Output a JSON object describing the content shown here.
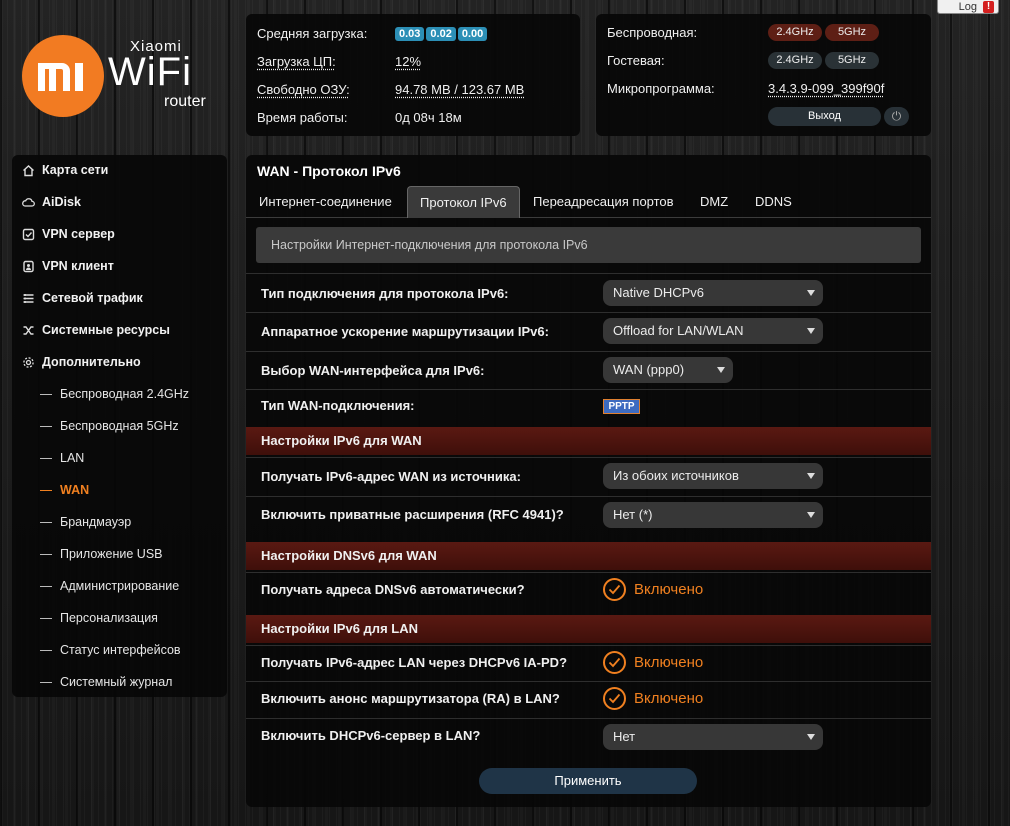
{
  "topbar": {
    "log_label": "Log",
    "warn_symbol": "!"
  },
  "logo": {
    "brand_small": "Xiaomi",
    "brand_big": "WiFi",
    "brand_router": "router",
    "mi_text": "MI"
  },
  "status": {
    "load_label": "Средняя загрузка:",
    "load_values": [
      "0.03",
      "0.02",
      "0.00"
    ],
    "cpu_label": "Загрузка ЦП:",
    "cpu_value": "12%",
    "ram_label": "Свободно ОЗУ:",
    "ram_value": "94.78 MB / 123.67 MB",
    "uptime_label": "Время работы:",
    "uptime_value": "0д 08ч 18м"
  },
  "wireless": {
    "wireless_label": "Беспроводная:",
    "guest_label": "Гостевая:",
    "firmware_label": "Микропрограмма:",
    "band_24": "2.4GHz",
    "band_5": "5GHz",
    "firmware_value": "3.4.3.9-099_399f90f",
    "exit_label": "Выход",
    "power_symbol": "⏻"
  },
  "sidebar": {
    "items": [
      {
        "label": "Карта сети",
        "icon": "home-icon"
      },
      {
        "label": "AiDisk",
        "icon": "cloud-icon"
      },
      {
        "label": "VPN сервер",
        "icon": "vpn-server-icon"
      },
      {
        "label": "VPN клиент",
        "icon": "vpn-client-icon"
      },
      {
        "label": "Сетевой трафик",
        "icon": "traffic-icon"
      },
      {
        "label": "Системные ресурсы",
        "icon": "resources-icon"
      },
      {
        "label": "Дополнительно",
        "icon": "gear-icon"
      }
    ],
    "subitems": [
      "Беспроводная 2.4GHz",
      "Беспроводная 5GHz",
      "LAN",
      "WAN",
      "Брандмауэр",
      "Приложение USB",
      "Администрирование",
      "Персонализация",
      "Статус интерфейсов",
      "Системный журнал"
    ],
    "active_subitem": "WAN"
  },
  "main": {
    "title": "WAN - Протокол IPv6",
    "tabs": [
      "Интернет-соединение",
      "Протокол IPv6",
      "Переадресация портов",
      "DMZ",
      "DDNS"
    ],
    "active_tab": "Протокол IPv6",
    "notice": "Настройки Интернет-подключения для протокола IPv6",
    "rows": {
      "conn_type_label": "Тип подключения для протокола IPv6:",
      "conn_type_value": "Native DHCPv6",
      "hw_accel_label": "Аппаратное ускорение маршрутизации IPv6:",
      "hw_accel_value": "Offload for LAN/WLAN",
      "wan_iface_label": "Выбор WAN-интерфейса для IPv6:",
      "wan_iface_value": "WAN (ppp0)",
      "wan_type_label": "Тип WAN-подключения:",
      "wan_type_value": "PPTP"
    },
    "section_wan": "Настройки IPv6 для WAN",
    "wan_rows": {
      "addr_source_label": "Получать IPv6-адрес WAN из источника:",
      "addr_source_value": "Из обоих источников",
      "privacy_label": "Включить приватные расширения (RFC 4941)?",
      "privacy_value": "Нет (*)"
    },
    "section_dns": "Настройки DNSv6 для WAN",
    "dns_rows": {
      "dns_auto_label": "Получать адреса DNSv6 автоматически?",
      "dns_auto_value": "Включено"
    },
    "section_lan": "Настройки IPv6 для LAN",
    "lan_rows": {
      "iapd_label": "Получать IPv6-адрес LAN через DHCPv6 IA-PD?",
      "iapd_value": "Включено",
      "ra_label": "Включить анонс маршрутизатора (RA) в LAN?",
      "ra_value": "Включено",
      "dhcp_label": "Включить DHCPv6-сервер в LAN?",
      "dhcp_value": "Нет"
    },
    "apply_label": "Применить"
  },
  "colors": {
    "accent_orange": "#f08020",
    "section_red": "#5a1912",
    "badge_blue": "#2c8fb6",
    "pill_red": "#5e1f15"
  }
}
